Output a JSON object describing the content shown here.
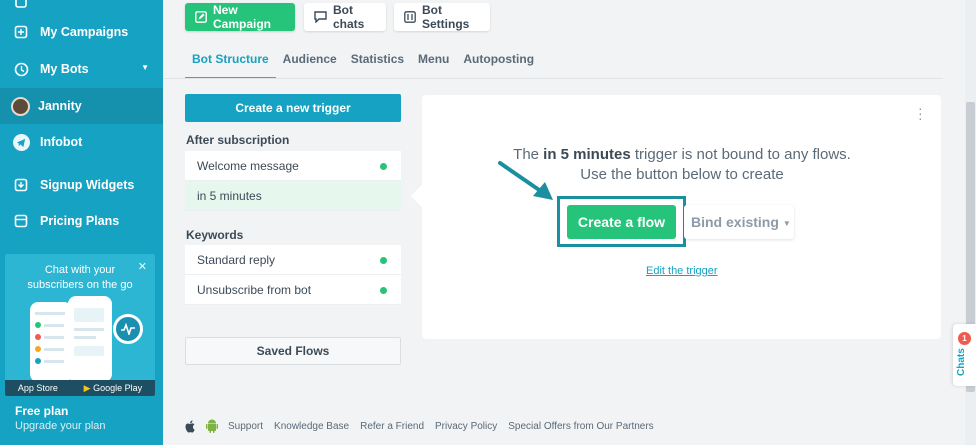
{
  "sidebar": {
    "items": [
      {
        "label": "My Campaigns"
      },
      {
        "label": "My Bots"
      },
      {
        "label": "Jannity"
      },
      {
        "label": "Infobot"
      },
      {
        "label": "Signup Widgets"
      },
      {
        "label": "Pricing Plans"
      }
    ],
    "promo": {
      "line1": "Chat with your",
      "line2": "subscribers on the go",
      "app_store": "App Store",
      "google_play": "Google Play"
    },
    "plan": "Free plan",
    "upgrade": "Upgrade your plan"
  },
  "toolbar": {
    "new_campaign": "New Campaign",
    "bot_chats": "Bot chats",
    "bot_settings": "Bot Settings"
  },
  "tabs": [
    {
      "label": "Bot Structure"
    },
    {
      "label": "Audience"
    },
    {
      "label": "Statistics"
    },
    {
      "label": "Menu"
    },
    {
      "label": "Autoposting"
    }
  ],
  "left_panel": {
    "create_trigger": "Create a new trigger",
    "after_subscription": "After subscription",
    "after_items": [
      {
        "label": "Welcome message"
      },
      {
        "label": "in 5 minutes"
      }
    ],
    "keywords": "Keywords",
    "keyword_items": [
      {
        "label": "Standard reply"
      },
      {
        "label": "Unsubscribe from bot"
      }
    ],
    "saved_flows": "Saved Flows"
  },
  "card": {
    "msg_prefix": "The ",
    "msg_bold": "in 5 minutes",
    "msg_suffix": " trigger is not bound to any flows. Use the button below to create",
    "create_flow": "Create a flow",
    "bind_existing": "Bind existing",
    "edit_trigger": "Edit the trigger"
  },
  "footer": {
    "links": [
      "Support",
      "Knowledge Base",
      "Refer a Friend",
      "Privacy Policy",
      "Special Offers from Our Partners"
    ]
  },
  "chats": {
    "label": "Chats",
    "badge": "1"
  },
  "colors": {
    "sidebar": "#16a2c2",
    "accent_green": "#25c47a",
    "highlight": "#1a8fa0"
  }
}
